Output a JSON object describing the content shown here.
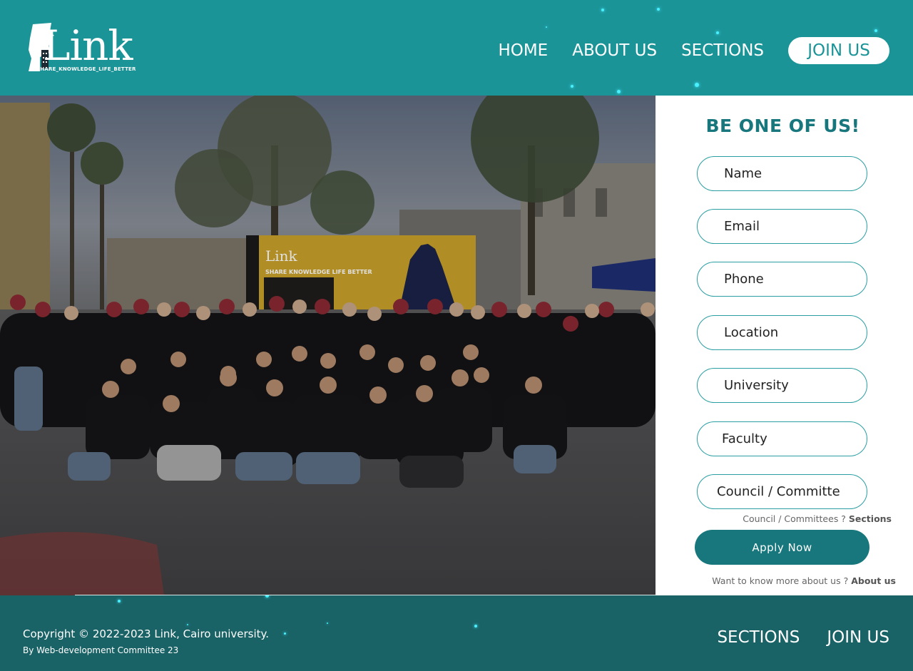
{
  "header": {
    "logo_text": "Link",
    "logo_tagline": "#SHARE_KNOWLEDGE_LIFE_BETTER",
    "nav": [
      {
        "label": "HOME"
      },
      {
        "label": "ABOUT US"
      },
      {
        "label": "SECTIONS"
      }
    ],
    "join_label": "JOIN US"
  },
  "hero": {
    "banner_logo": "Link",
    "banner_tagline": "SHARE KNOWLEDGE LIFE BETTER"
  },
  "form": {
    "title": "BE ONE OF US!",
    "fields": {
      "name": "Name",
      "email": "Email",
      "phone": "Phone",
      "location": "Location",
      "university": "University",
      "faculty": "Faculty",
      "council": "Council / Committe"
    },
    "council_hint": "Council / Committees ?",
    "council_hint_link": "Sections",
    "apply_label": "Apply Now",
    "about_hint": "Want to know more about us ?",
    "about_hint_link": "About us"
  },
  "footer": {
    "copyright": "Copyright ©  2022-2023 Link, Cairo university.",
    "byline": "By Web-development Committee 23",
    "nav": [
      {
        "label": "SECTIONS"
      },
      {
        "label": "JOIN US"
      }
    ]
  },
  "colors": {
    "header_bg": "#1b9498",
    "footer_bg": "#196266",
    "accent": "#17777c",
    "field_border": "#2a9ea2"
  }
}
